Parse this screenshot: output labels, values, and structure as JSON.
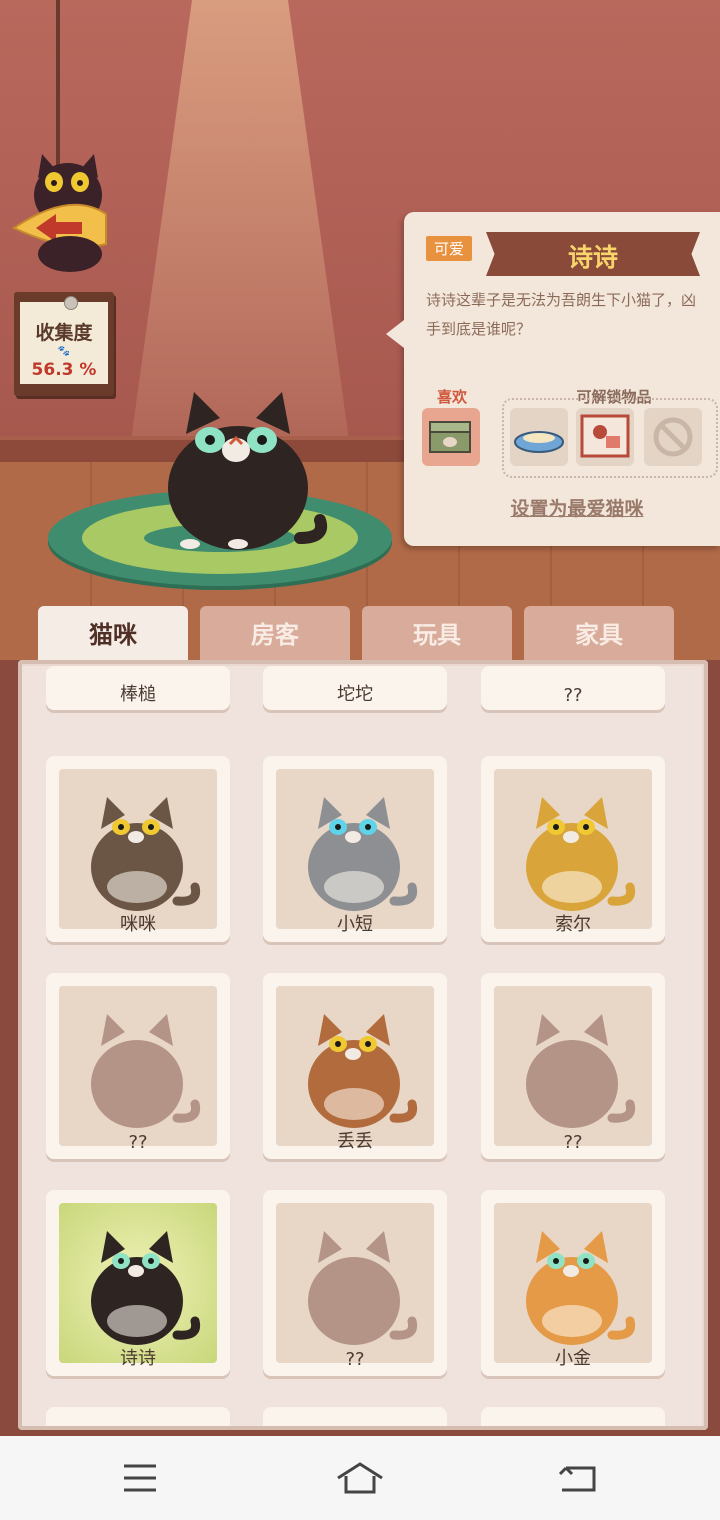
{
  "collection": {
    "label": "收集度",
    "value": "56.3 %"
  },
  "selected_cat": {
    "trait": "可爱",
    "name": "诗诗",
    "description": "诗诗这辈子是无法为吾朗生下小猫了，凶手到底是谁呢？",
    "likes_label": "喜欢",
    "unlockables_label": "可解锁物品",
    "favorite_action": "设置为最爱猫咪"
  },
  "tabs": [
    {
      "label": "猫咪",
      "active": true
    },
    {
      "label": "房客",
      "active": false
    },
    {
      "label": "玩具",
      "active": false
    },
    {
      "label": "家具",
      "active": false
    }
  ],
  "cats_partial_row": [
    "棒槌",
    "坨坨",
    "??"
  ],
  "cats": [
    {
      "name": "咪咪",
      "fur": "#6b5645",
      "eyes": "#f0c832",
      "unlocked": true
    },
    {
      "name": "小短",
      "fur": "#8d8f93",
      "eyes": "#5fd3e8",
      "unlocked": true
    },
    {
      "name": "索尔",
      "fur": "#d9a53a",
      "eyes": "#f0c832",
      "unlocked": true
    },
    {
      "name": "??",
      "unlocked": false
    },
    {
      "name": "丢丢",
      "fur": "#b26b3c",
      "eyes": "#f0c832",
      "unlocked": true
    },
    {
      "name": "??",
      "unlocked": false
    },
    {
      "name": "诗诗",
      "fur": "#2e2422",
      "eyes": "#8fe3c4",
      "unlocked": true,
      "selected": true
    },
    {
      "name": "??",
      "unlocked": false
    },
    {
      "name": "小金",
      "fur": "#e49a46",
      "eyes": "#8fe3c4",
      "unlocked": true
    }
  ],
  "colors": {
    "accent": "#e8913e",
    "ribbon": "#8a4a3a",
    "name": "#f8d56a"
  },
  "nav": [
    "menu-icon",
    "home-icon",
    "back-icon"
  ]
}
